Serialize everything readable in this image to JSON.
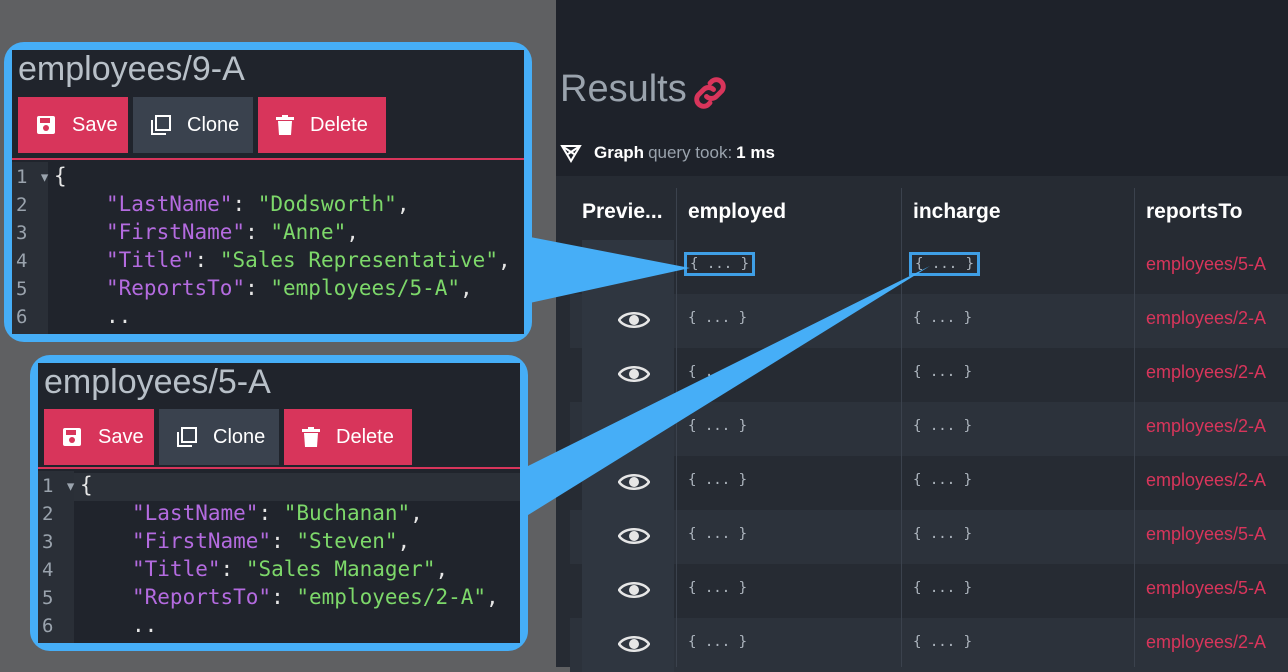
{
  "results": {
    "title": "Results",
    "graph_label": "Graph",
    "query_took_label": "query took:",
    "query_time": "1 ms"
  },
  "table": {
    "headers": [
      "Previe...",
      "employed",
      "incharge",
      "reportsTo"
    ],
    "rows": [
      {
        "employed": "{ ... }",
        "incharge": "{ ... }",
        "reportsTo": "employees/5-A"
      },
      {
        "employed": "{ ... }",
        "incharge": "{ ... }",
        "reportsTo": "employees/2-A"
      },
      {
        "employed": "{ ... }",
        "incharge": "{ ... }",
        "reportsTo": "employees/2-A"
      },
      {
        "employed": "{ ... }",
        "incharge": "{ ... }",
        "reportsTo": "employees/2-A"
      },
      {
        "employed": "{ ... }",
        "incharge": "{ ... }",
        "reportsTo": "employees/2-A"
      },
      {
        "employed": "{ ... }",
        "incharge": "{ ... }",
        "reportsTo": "employees/5-A"
      },
      {
        "employed": "{ ... }",
        "incharge": "{ ... }",
        "reportsTo": "employees/5-A"
      },
      {
        "employed": "{ ... }",
        "incharge": "{ ... }",
        "reportsTo": "employees/2-A"
      }
    ]
  },
  "doc1": {
    "title": "employees/9-A",
    "save": "Save",
    "clone": "Clone",
    "delete": "Delete",
    "lines": [
      {
        "n": "1",
        "text": "{"
      },
      {
        "n": "2",
        "key": "\"LastName\"",
        "val": "\"Dodsworth\""
      },
      {
        "n": "3",
        "key": "\"FirstName\"",
        "val": "\"Anne\""
      },
      {
        "n": "4",
        "key": "\"Title\"",
        "val": "\"Sales Representative\""
      },
      {
        "n": "5",
        "key": "\"ReportsTo\"",
        "val": "\"employees/5-A\""
      },
      {
        "n": "6",
        "text": ".."
      }
    ]
  },
  "doc2": {
    "title": "employees/5-A",
    "save": "Save",
    "clone": "Clone",
    "delete": "Delete",
    "lines": [
      {
        "n": "1",
        "text": "{"
      },
      {
        "n": "2",
        "key": "\"LastName\"",
        "val": "\"Buchanan\""
      },
      {
        "n": "3",
        "key": "\"FirstName\"",
        "val": "\"Steven\""
      },
      {
        "n": "4",
        "key": "\"Title\"",
        "val": "\"Sales Manager\""
      },
      {
        "n": "5",
        "key": "\"ReportsTo\"",
        "val": "\"employees/2-A\""
      },
      {
        "n": "6",
        "text": ".."
      }
    ]
  },
  "colors": {
    "accent": "#d8355b",
    "callout": "#46aef7",
    "bg": "#1e222a"
  }
}
